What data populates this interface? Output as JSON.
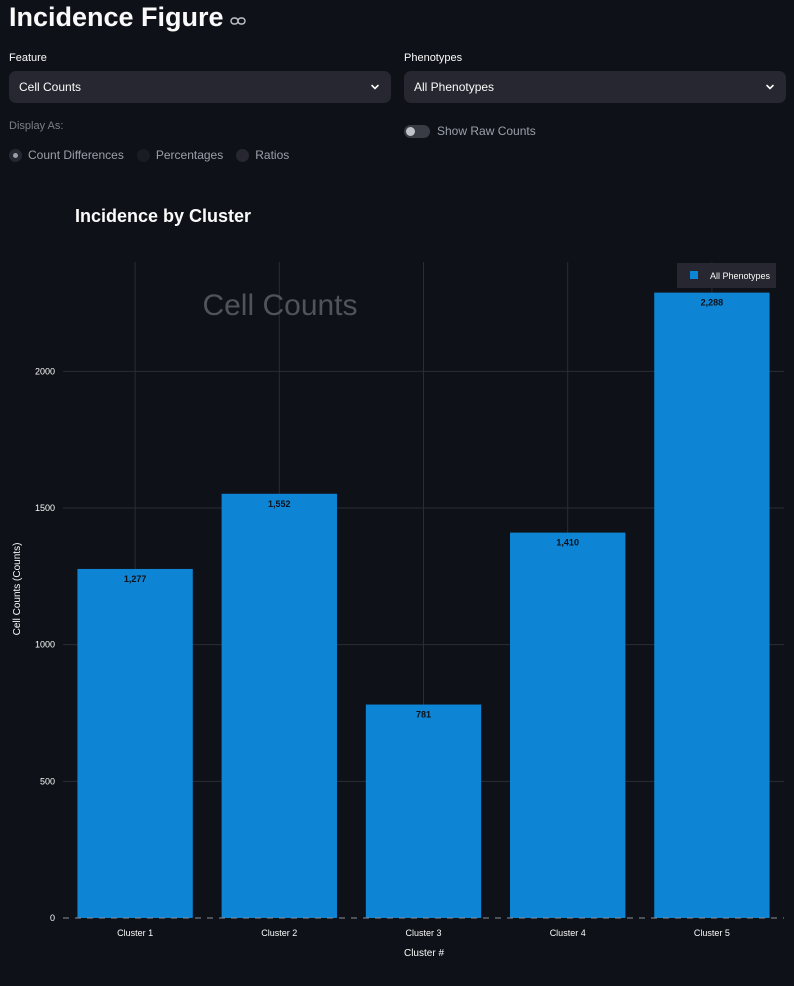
{
  "header": {
    "title": "Incidence Figure"
  },
  "controls": {
    "feature_label": "Feature",
    "feature_value": "Cell Counts",
    "phenotypes_label": "Phenotypes",
    "phenotypes_value": "All Phenotypes",
    "display_as_label": "Display As:",
    "display_options": [
      "Count Differences",
      "Percentages",
      "Ratios"
    ],
    "display_selected": "Count Differences",
    "toggle_label": "Show Raw Counts",
    "toggle_on": false
  },
  "chart_data": {
    "type": "bar",
    "title": "Incidence by Cluster",
    "annotation": "Cell Counts",
    "xlabel": "Cluster #",
    "ylabel": "Cell Counts (Counts)",
    "categories": [
      "Cluster 1",
      "Cluster 2",
      "Cluster 3",
      "Cluster 4",
      "Cluster 5"
    ],
    "series": [
      {
        "name": "All Phenotypes",
        "values": [
          1277,
          1552,
          781,
          1410,
          2288
        ],
        "labels": [
          "1,277",
          "1,552",
          "781",
          "1,410",
          "2,288"
        ],
        "color": "#0d84d4"
      }
    ],
    "yticks": [
      0,
      500,
      1000,
      1500,
      2000
    ],
    "ylim": [
      0,
      2400
    ],
    "grid": true,
    "legend_position": "top-right"
  }
}
